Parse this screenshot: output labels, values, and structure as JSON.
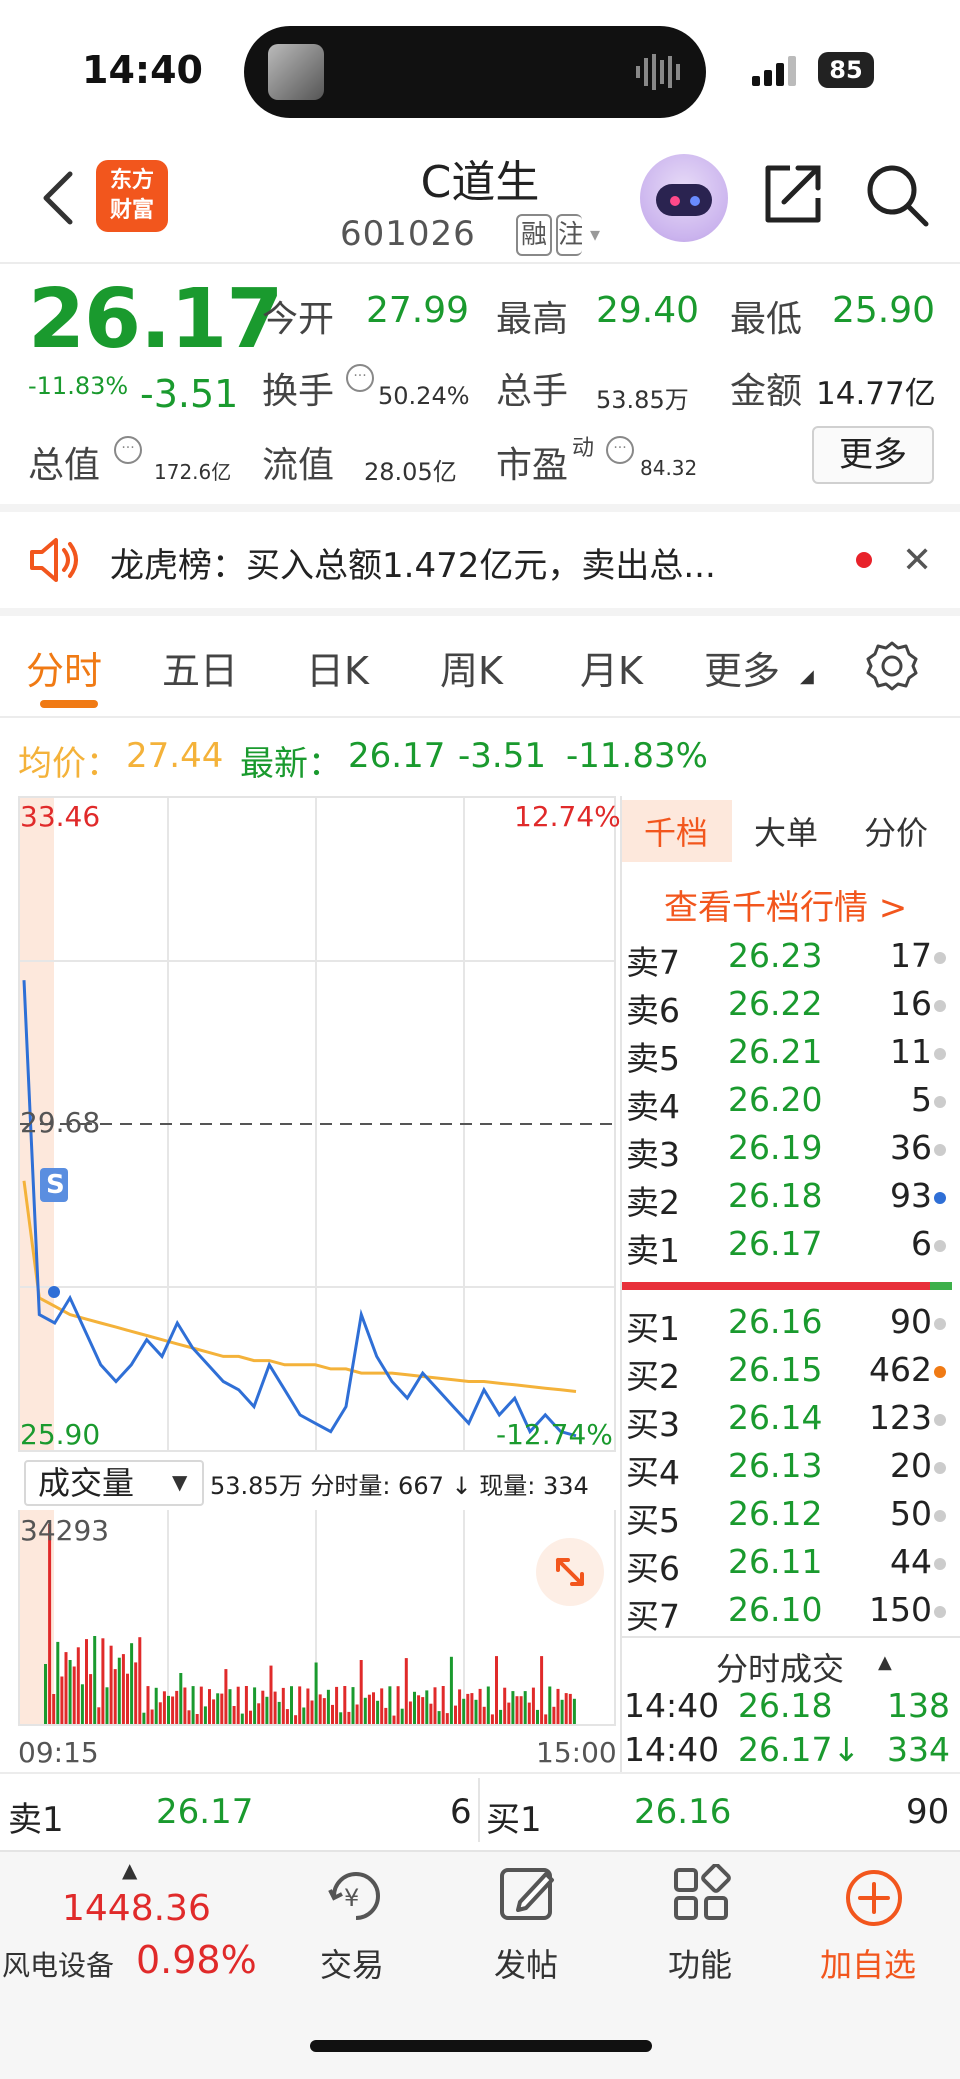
{
  "status": {
    "time": "14:40",
    "battery": "85"
  },
  "header": {
    "name": "C道生",
    "code": "601026",
    "tag1": "融",
    "tag2": "注"
  },
  "quote": {
    "price": "26.17",
    "pct": "-11.83%",
    "chg": "-3.51",
    "open_label": "今开",
    "open": "27.99",
    "high_label": "最高",
    "high": "29.40",
    "low_label": "最低",
    "low": "25.90",
    "turnover_label": "换手",
    "turnover": "50.24%",
    "volume_label": "总手",
    "volume": "53.85万",
    "amount_label": "金额",
    "amount": "14.77亿",
    "mktcap_label": "总值",
    "mktcap": "172.6亿",
    "float_label": "流值",
    "float": "28.05亿",
    "pe_label": "市盈",
    "pe_sup": "动",
    "pe": "84.32",
    "more": "更多"
  },
  "notice": {
    "text": "龙虎榜：买入总额1.472亿元，卖出总..."
  },
  "tabs": [
    "分时",
    "五日",
    "日K",
    "周K",
    "月K",
    "更多"
  ],
  "info": {
    "avg_label": "均价：",
    "avg": "27.44",
    "last_label": "最新：",
    "last": "26.17",
    "chg": "-3.51",
    "pct": "-11.83%"
  },
  "chart": {
    "top_price": "33.46",
    "top_pct": "12.74%",
    "prev_close": "29.68",
    "bottom_price": "25.90",
    "bottom_pct": "-12.74%",
    "vol_select": "成交量",
    "vol_info": "53.85万 分时量: 667 ↓ 现量: 334",
    "vol_max": "34293",
    "time_start": "09:15",
    "time_end": "15:00",
    "s_marker": "S"
  },
  "chart_data": {
    "type": "line",
    "series": [
      {
        "values": [
          31.4,
          27.4,
          27.3,
          27.6,
          27.2,
          26.8,
          26.6,
          26.8,
          27.1,
          26.9,
          27.3,
          27.0,
          26.8,
          26.6,
          26.5,
          26.3,
          26.8,
          26.5,
          26.2,
          26.1,
          26.0,
          26.3,
          27.4,
          26.9,
          26.6,
          26.4,
          26.7,
          26.5,
          26.3,
          26.1,
          26.5,
          26.2,
          26.4,
          26.0,
          26.2,
          26.0,
          25.95
        ]
      },
      {
        "values": [
          29.0,
          27.6,
          27.5,
          27.4,
          27.35,
          27.3,
          27.25,
          27.2,
          27.15,
          27.1,
          27.05,
          27.0,
          26.95,
          26.9,
          26.9,
          26.85,
          26.85,
          26.8,
          26.8,
          26.8,
          26.75,
          26.75,
          26.7,
          26.7,
          26.7,
          26.68,
          26.66,
          26.64,
          26.62,
          26.6,
          26.6,
          26.58,
          26.56,
          26.54,
          26.52,
          26.5,
          26.48
        ]
      }
    ],
    "ylim": [
      25.9,
      33.46
    ],
    "volume_max": 34293
  },
  "orderbook": {
    "tabs": [
      "千档",
      "大单",
      "分价"
    ],
    "link": "查看千档行情 >",
    "asks": [
      {
        "label": "卖7",
        "price": "26.23",
        "qty": "17",
        "dot": "#cccccc"
      },
      {
        "label": "卖6",
        "price": "26.22",
        "qty": "16",
        "dot": "#cccccc"
      },
      {
        "label": "卖5",
        "price": "26.21",
        "qty": "11",
        "dot": "#cccccc"
      },
      {
        "label": "卖4",
        "price": "26.20",
        "qty": "5",
        "dot": "#cccccc"
      },
      {
        "label": "卖3",
        "price": "26.19",
        "qty": "36",
        "dot": "#cccccc"
      },
      {
        "label": "卖2",
        "price": "26.18",
        "qty": "93",
        "dot": "#2f6fd6"
      },
      {
        "label": "卖1",
        "price": "26.17",
        "qty": "6",
        "dot": "#cccccc"
      }
    ],
    "bids": [
      {
        "label": "买1",
        "price": "26.16",
        "qty": "90",
        "dot": "#cccccc"
      },
      {
        "label": "买2",
        "price": "26.15",
        "qty": "462",
        "dot": "#f07a14"
      },
      {
        "label": "买3",
        "price": "26.14",
        "qty": "123",
        "dot": "#cccccc"
      },
      {
        "label": "买4",
        "price": "26.13",
        "qty": "20",
        "dot": "#cccccc"
      },
      {
        "label": "买5",
        "price": "26.12",
        "qty": "50",
        "dot": "#cccccc"
      },
      {
        "label": "买6",
        "price": "26.11",
        "qty": "44",
        "dot": "#cccccc"
      },
      {
        "label": "买7",
        "price": "26.10",
        "qty": "150",
        "dot": "#cccccc"
      }
    ],
    "ticks_title": "分时成交",
    "ticks": [
      {
        "time": "14:40",
        "price": "26.18",
        "qty": "138"
      },
      {
        "time": "14:40",
        "price": "26.17↓",
        "qty": "334"
      }
    ]
  },
  "strip": {
    "sell_label": "卖1",
    "sell_price": "26.17",
    "sell_qty": "6",
    "buy_label": "买1",
    "buy_price": "26.16",
    "buy_qty": "90"
  },
  "nav": {
    "index_value": "1448.36",
    "index_name": "风电设备",
    "index_pct": "0.98%",
    "trade": "交易",
    "post": "发帖",
    "func": "功能",
    "add": "加自选"
  },
  "colors": {
    "up": "#e02a2a",
    "down": "#1a9a2e",
    "accent": "#f07a14",
    "price_line": "#2f6fd6",
    "avg_line": "#f4b23a"
  }
}
